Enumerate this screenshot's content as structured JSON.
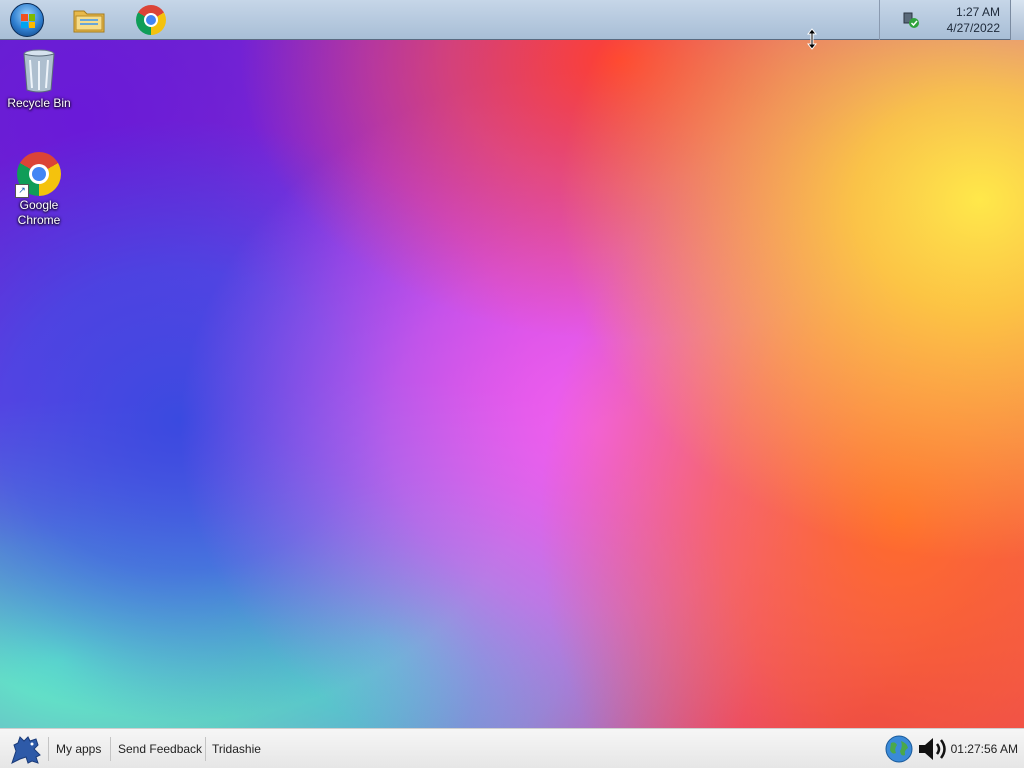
{
  "desktop": {
    "icons": [
      {
        "label": "Recycle Bin",
        "icon": "recycle-bin-icon"
      },
      {
        "label": "Google\nChrome",
        "icon": "chrome-icon"
      }
    ]
  },
  "top_taskbar": {
    "buttons": [
      {
        "name": "start-button",
        "icon": "windows-start-orb-icon"
      },
      {
        "name": "file-explorer",
        "icon": "folder-icon"
      },
      {
        "name": "google-chrome",
        "icon": "chrome-icon"
      }
    ],
    "tray": {
      "time": "1:27 AM",
      "date": "4/27/2022",
      "icons": [
        "network-icon"
      ]
    }
  },
  "bottom_bar": {
    "logo_icon": "dinosaur-icon",
    "links": [
      "My apps",
      "Send Feedback",
      "Tridashie"
    ],
    "right_icons": [
      "globe-icon",
      "speaker-icon"
    ],
    "clock": "01:27:56 AM"
  },
  "colors": {
    "taskbar": "#b6c8dc",
    "bottom_bar": "#eeeeee"
  }
}
